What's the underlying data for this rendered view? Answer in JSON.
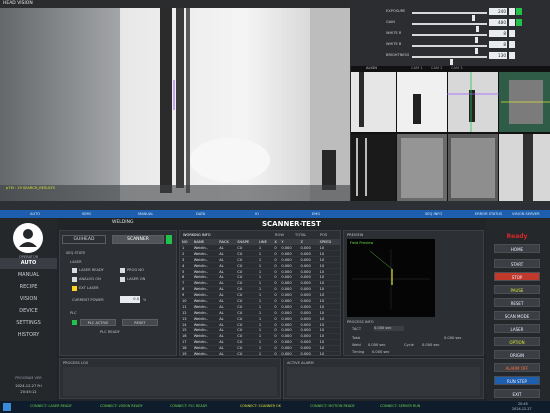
{
  "camera": {
    "title": "HEAD VISION",
    "overlay": "p7M : 19 SEARCH_RESULTS"
  },
  "sliders": [
    {
      "label": "EXPOSURE",
      "value": "240"
    },
    {
      "label": "GAIN",
      "value": "480"
    },
    {
      "label": "WHITE R",
      "value": "8"
    },
    {
      "label": "WHITE B",
      "value": "8"
    },
    {
      "label": "BRIGHTNESS",
      "value": "130"
    }
  ],
  "thumbs": {
    "label": "ALIGN",
    "tabs": [
      "CAM 1",
      "CAM 2",
      "CAM 3"
    ]
  },
  "status_strip": [
    "AUTO",
    "SEMI",
    "MANUAL",
    "DATA",
    "IO",
    "EMG",
    "SEQ INFO",
    "ERROR STATUS",
    "VISION SERVER"
  ],
  "nav": {
    "user": "OPERATOR",
    "items": [
      "AUTO",
      "MANUAL",
      "RECIPE",
      "VISION",
      "DEVICE",
      "SETTINGS",
      "HISTORY"
    ],
    "clock_label": "PROGRAM VER",
    "clock_date": "2024-12-27 Fri",
    "clock_time": "20:45:12"
  },
  "main": {
    "tabs": [
      "WELDING",
      "SCANNER-TEST"
    ],
    "left": {
      "guihead": "GUIHEAD",
      "scanner": "SCANNER",
      "section_state": "SEQ STATE",
      "laser": "LASER",
      "chk1": "LASER READY",
      "chk2": "PROG NO",
      "chk3": "ANALOG ON",
      "chk4": "LASER ON",
      "chk5": "EXT LASER",
      "power_label": "CURRENT POWER",
      "power_value": "0.0",
      "power_unit": "%",
      "plc": "PLC",
      "plc_btn": "PLC ACTIVE",
      "reset": "RESET",
      "plc_sub": "PLC READY"
    },
    "table": {
      "title": "WORKING INFO",
      "sub1": "ROW",
      "sub2": "TOTAL",
      "sub3": "POS",
      "headers": [
        "NO",
        "NAME",
        "RACK",
        "SHAPE",
        "LINE",
        "X",
        "Y",
        "Z",
        "SPEED"
      ],
      "rows": [
        [
          "1",
          "Weldin..",
          "AL",
          "CU",
          "1",
          "0",
          "0.000",
          "0.000",
          "10"
        ],
        [
          "2",
          "Weldin..",
          "AL",
          "CU",
          "1",
          "0",
          "0.000",
          "0.000",
          "10"
        ],
        [
          "3",
          "Weldin..",
          "AL",
          "CU",
          "1",
          "0",
          "0.000",
          "0.000",
          "10"
        ],
        [
          "4",
          "Weldin..",
          "AL",
          "CU",
          "1",
          "0",
          "0.000",
          "0.000",
          "10"
        ],
        [
          "5",
          "Weldin..",
          "AL",
          "CU",
          "1",
          "0",
          "0.000",
          "0.000",
          "10"
        ],
        [
          "6",
          "Weldin..",
          "AL",
          "CU",
          "1",
          "0",
          "0.000",
          "0.000",
          "10"
        ],
        [
          "7",
          "Weldin..",
          "AL",
          "CU",
          "1",
          "0",
          "0.000",
          "0.000",
          "10"
        ],
        [
          "8",
          "Weldin..",
          "AL",
          "CU",
          "1",
          "0",
          "0.000",
          "0.000",
          "10"
        ],
        [
          "9",
          "Weldin..",
          "AL",
          "CU",
          "1",
          "0",
          "0.000",
          "0.000",
          "10"
        ],
        [
          "10",
          "Weldin..",
          "AL",
          "CU",
          "1",
          "0",
          "0.000",
          "0.000",
          "10"
        ],
        [
          "11",
          "Weldin..",
          "AL",
          "CU",
          "1",
          "0",
          "0.000",
          "0.000",
          "10"
        ],
        [
          "12",
          "Weldin..",
          "AL",
          "CU",
          "1",
          "0",
          "0.000",
          "0.000",
          "10"
        ],
        [
          "13",
          "Weldin..",
          "AL",
          "CU",
          "1",
          "0",
          "0.000",
          "0.000",
          "10"
        ],
        [
          "14",
          "Weldin..",
          "AL",
          "CU",
          "1",
          "0",
          "0.000",
          "0.000",
          "10"
        ],
        [
          "15",
          "Weldin..",
          "AL",
          "CU",
          "1",
          "0",
          "0.000",
          "0.000",
          "10"
        ],
        [
          "16",
          "Weldin..",
          "AL",
          "CU",
          "1",
          "0",
          "0.000",
          "0.000",
          "10"
        ],
        [
          "17",
          "Weldin..",
          "AL",
          "CU",
          "1",
          "0",
          "0.000",
          "0.000",
          "10"
        ],
        [
          "18",
          "Weldin..",
          "AL",
          "CU",
          "1",
          "0",
          "0.000",
          "0.000",
          "10"
        ],
        [
          "19",
          "Weldin..",
          "AL",
          "CU",
          "1",
          "0",
          "0.000",
          "0.000",
          "10"
        ],
        [
          "20",
          "Weldin..",
          "AL",
          "CU",
          "1",
          "0",
          "0.000",
          "0.000",
          "10"
        ],
        [
          "21",
          "Weldin..",
          "AL",
          "CU",
          "1",
          "0",
          "0.000",
          "0.000",
          "10"
        ],
        [
          "22",
          "Weldin..",
          "AL",
          "CU",
          "1",
          "0",
          "0.000",
          "0.000",
          "10"
        ],
        [
          "23",
          "Weldin..",
          "AL",
          "CU",
          "1",
          "0",
          "0.000",
          "0.000",
          "10"
        ],
        [
          "24",
          "Weldin..",
          "AL",
          "CU",
          "1",
          "0",
          "0.000",
          "0.000",
          "10"
        ],
        [
          "25",
          "Weldin..",
          "AL",
          "CU",
          "1",
          "0",
          "0.000",
          "0.000",
          "10"
        ]
      ]
    },
    "preview": {
      "title": "PREVIEW",
      "caption": "Field Preview",
      "process_title": "PROCESS INFO",
      "tact_label": "TACT",
      "tact_value": "0.000 sec",
      "total_label": "Total",
      "total_value": "0.000 sec",
      "weld_label": "Weld",
      "weld_value": "0.000 sec",
      "cycle_label": "Cycle",
      "cycle_value": "0.000 sec",
      "timing_label": "Timing",
      "timing_value": "0.000 sec"
    },
    "process_log": "PROCESS LOG",
    "active_alarm": "ACTIVE ALARM"
  },
  "right": {
    "status": "Ready",
    "buttons": [
      "HOME",
      "START",
      "STOP",
      "PAUSE",
      "RESET",
      "SCAN MODE",
      "LASER",
      "OPTION",
      "ORIGIN",
      "ALARM OFF",
      "RUN STEP",
      "EXIT"
    ]
  },
  "taskbar": {
    "items": [
      "CONNECT: LASER READY",
      "CONNECT: VISION READY",
      "CONNECT: PLC READY",
      "CONNECT: SCANNER OK",
      "CONNECT: MOTION READY",
      "CONNECT: SERVER RUN"
    ],
    "clock": "20:45",
    "date": "2024-12-27"
  },
  "colors": {
    "accent": "#1d5fae",
    "ok": "#22c24a",
    "stop": "#c0392b",
    "brand_red": "#d62828"
  }
}
